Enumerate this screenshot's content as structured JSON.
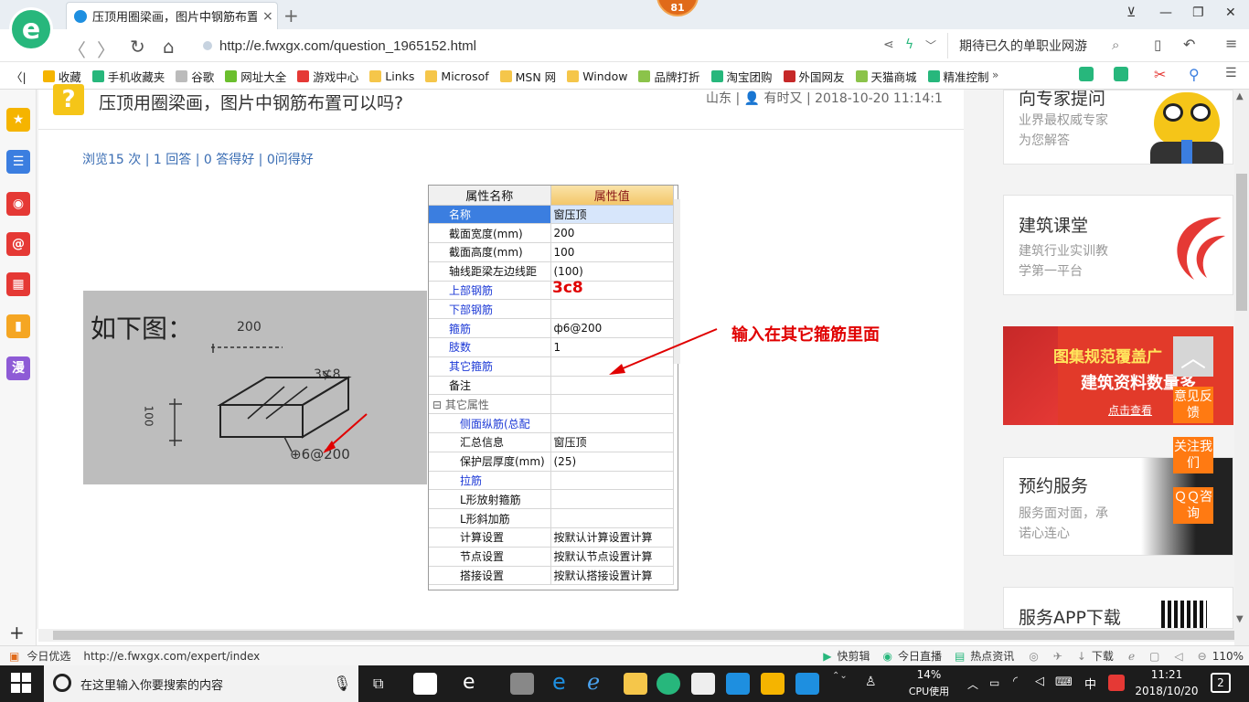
{
  "browser": {
    "logo": "e",
    "tab_title": "压顶用圈梁画，图片中钢筋布置可",
    "tab_close": "×",
    "new_tab": "+",
    "badge": "81",
    "window": {
      "skin": "⊻",
      "minimize": "—",
      "restore": "❐",
      "close": "✕"
    },
    "nav": {
      "back": "〈",
      "forward": "〉",
      "refresh": "↻",
      "home": "⌂"
    },
    "url": "http://e.fwxgx.com/question_1965152.html",
    "search_text": "期待已久的单职业网游",
    "bookmarks": [
      {
        "label": "收藏",
        "color": "#f5b400"
      },
      {
        "label": "手机收藏夹",
        "color": "#27b77c"
      },
      {
        "label": "谷歌",
        "color": "#bbbbbb"
      },
      {
        "label": "网址大全",
        "color": "#6bbf2e"
      },
      {
        "label": "游戏中心",
        "color": "#e53935"
      },
      {
        "label": "Links",
        "color": "#f5c64a"
      },
      {
        "label": "Microsof",
        "color": "#f5c64a"
      },
      {
        "label": "MSN 网",
        "color": "#f5c64a"
      },
      {
        "label": "Window",
        "color": "#f5c64a"
      },
      {
        "label": "品牌打折",
        "color": "#8bc34a"
      },
      {
        "label": "淘宝团购",
        "color": "#27b77c"
      },
      {
        "label": "外国网友",
        "color": "#c62828"
      },
      {
        "label": "天猫商城",
        "color": "#8bc34a"
      },
      {
        "label": "精准控制",
        "color": "#27b77c"
      }
    ],
    "bookmarks_more": "»",
    "collapse": "〈|"
  },
  "sidebar": {
    "items": [
      {
        "name": "favorites-star-icon",
        "glyph": "★",
        "color": "#f5b400"
      },
      {
        "name": "news-feed-icon",
        "glyph": "☰",
        "color": "#3b7ee0"
      },
      {
        "name": "weibo-icon",
        "glyph": "◉",
        "color": "#e53935"
      },
      {
        "name": "mail-icon",
        "glyph": "@",
        "color": "#e53935"
      },
      {
        "name": "game-icon",
        "glyph": "▦",
        "color": "#e53935"
      },
      {
        "name": "book-icon",
        "glyph": "▮",
        "color": "#f5a623"
      },
      {
        "name": "manga-icon",
        "glyph": "漫",
        "color": "#8e5bd6"
      }
    ],
    "add": "+"
  },
  "question": {
    "icon": "?",
    "title": "压顶用圈梁画，图片中钢筋布置可以吗?",
    "meta": "山东 | 👤 有时又 | 2018-10-20 11:14:1",
    "stats": "浏览15 次 | 1 回答 | 0 答得好 | 0问得好"
  },
  "photo": {
    "caption": "如下图：",
    "dim_top": "200",
    "bars": "3⊈8",
    "dim_side": "100",
    "stirrup": "⊕6@200"
  },
  "property_table": {
    "header_name": "属性名称",
    "header_value": "属性值",
    "rows": [
      {
        "name": "名称",
        "value": "窗压顶",
        "style": "blue",
        "selected": true
      },
      {
        "name": "截面宽度(mm)",
        "value": "200",
        "style": ""
      },
      {
        "name": "截面高度(mm)",
        "value": "100",
        "style": ""
      },
      {
        "name": "轴线距梁左边线距",
        "value": "(100)",
        "style": ""
      },
      {
        "name": "上部钢筋",
        "value": "",
        "style": "blue"
      },
      {
        "name": "下部钢筋",
        "value": "",
        "style": "blue"
      },
      {
        "name": "箍筋",
        "value": "ф6@200",
        "style": "blue"
      },
      {
        "name": "肢数",
        "value": "1",
        "style": "blue"
      },
      {
        "name": "其它箍筋",
        "value": "",
        "style": "blue"
      },
      {
        "name": "备注",
        "value": "",
        "style": ""
      },
      {
        "name": "⊟ 其它属性",
        "value": "",
        "style": "grp"
      },
      {
        "name": "侧面纵筋(总配",
        "value": "",
        "style": "sub blue"
      },
      {
        "name": "汇总信息",
        "value": "窗压顶",
        "style": "sub"
      },
      {
        "name": "保护层厚度(mm)",
        "value": "(25)",
        "style": "sub"
      },
      {
        "name": "拉筋",
        "value": "",
        "style": "sub blue"
      },
      {
        "name": "L形放射箍筋",
        "value": "",
        "style": "sub"
      },
      {
        "name": "L形斜加筋",
        "value": "",
        "style": "sub"
      },
      {
        "name": "计算设置",
        "value": "按默认计算设置计算",
        "style": "sub"
      },
      {
        "name": "节点设置",
        "value": "按默认节点设置计算",
        "style": "sub"
      },
      {
        "name": "搭接设置",
        "value": "按默认搭接设置计算",
        "style": "sub"
      }
    ],
    "handwritten_value": "3c8"
  },
  "annotation": "输入在其它箍筋里面",
  "right": {
    "expert": {
      "title": "向专家提问",
      "sub1": "业界最权威专家",
      "sub2": "为您解答"
    },
    "classroom": {
      "title": "建筑课堂",
      "sub1": "建筑行业实训教",
      "sub2": "学第一平台"
    },
    "banner": {
      "line1": "图集规范覆盖广",
      "line2": "建筑资料数量多",
      "button": "点击查看"
    },
    "booking": {
      "title": "预约服务",
      "sub1": "服务面对面，承",
      "sub2": "诺心连心"
    },
    "app": {
      "title": "服务APP下载"
    },
    "side_buttons": {
      "top": "︿",
      "feedback": "意见反馈",
      "follow": "关注我们",
      "qq": "ＱＱ咨询"
    }
  },
  "statusbar": {
    "left_label": "今日优选",
    "link": "http://e.fwxgx.com/expert/index",
    "items": [
      "快剪辑",
      "今日直播",
      "热点资讯",
      "下载"
    ],
    "zoom": "110%"
  },
  "taskbar": {
    "search_placeholder": "在这里输入你要搜索的内容",
    "cpu_percent": "14%",
    "cpu_label": "CPU使用",
    "ime": "中",
    "time": "11:21",
    "date": "2018/10/20",
    "notifications": "2"
  }
}
